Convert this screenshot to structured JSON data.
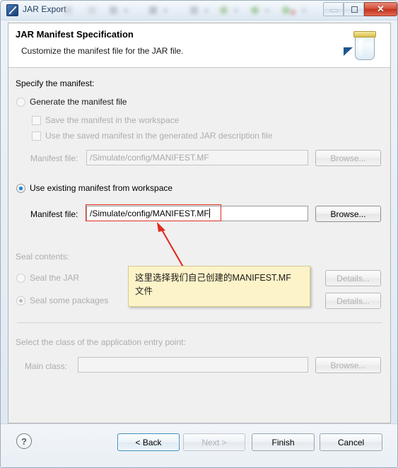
{
  "window": {
    "title": "JAR Export",
    "icon": "jar-export-icon",
    "controls": {
      "minimize": "minimize-icon",
      "maximize": "maximize-icon",
      "close": "✕"
    }
  },
  "header": {
    "title": "JAR Manifest Specification",
    "subtitle": "Customize the manifest file for the JAR file.",
    "icon": "jar-bottle-icon"
  },
  "main": {
    "specify_label": "Specify the manifest:",
    "generate_radio": {
      "label": "Generate the manifest file",
      "selected": false,
      "enabled": false
    },
    "checkboxes": [
      {
        "label": "Save the manifest in the workspace",
        "checked": false,
        "enabled": false
      },
      {
        "label": "Use the saved manifest in the generated JAR description file",
        "checked": false,
        "enabled": false
      }
    ],
    "generate_manifest_file": {
      "label": "Manifest file:",
      "value": "/Simulate/config/MANIFEST.MF",
      "enabled": false,
      "browse_label": "Browse..."
    },
    "existing_radio": {
      "label": "Use existing manifest from workspace",
      "selected": true,
      "enabled": true
    },
    "existing_manifest_file": {
      "label": "Manifest file:",
      "value": "/Simulate/config/MANIFEST.MF",
      "enabled": true,
      "browse_label": "Browse..."
    },
    "seal_label": "Seal contents:",
    "seal_jar_radio": {
      "label": "Seal the JAR",
      "selected": false,
      "enabled": false
    },
    "seal_packages_radio": {
      "label": "Seal some packages",
      "selected": true,
      "enabled": false
    },
    "seal_jar_details_label": "Details...",
    "seal_packages_details_label": "Details...",
    "entry_point_label": "Select the class of the application entry point:",
    "main_class": {
      "label": "Main class:",
      "value": "",
      "enabled": false,
      "browse_label": "Browse..."
    }
  },
  "footer": {
    "help_icon": "?",
    "back_label": "< Back",
    "next_label": "Next >",
    "finish_label": "Finish",
    "cancel_label": "Cancel"
  },
  "annotation": {
    "line1": "这里选择我们自己创建的MANIFEST.MF",
    "line2": "文件",
    "highlight_color": "#e02b20",
    "box_color": "#fdf3c8"
  }
}
